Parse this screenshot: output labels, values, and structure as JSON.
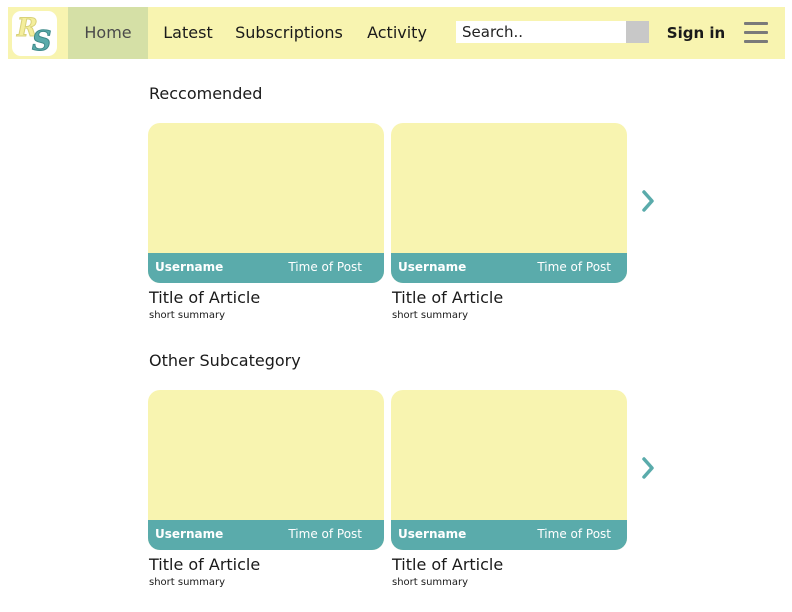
{
  "colors": {
    "header_bg": "#f8f4b0",
    "active_tab_bg": "#d5e0a6",
    "accent_teal": "#5aabab",
    "card_bg": "#f8f4b0",
    "search_button": "#c8c8c8",
    "menu_icon": "#7a7a7a"
  },
  "header": {
    "logo": {
      "letter1": "R",
      "letter2": "S"
    },
    "tabs": [
      {
        "label": "Home",
        "active": true
      },
      {
        "label": "Latest",
        "active": false
      },
      {
        "label": "Subscriptions",
        "active": false
      },
      {
        "label": "Activity",
        "active": false
      }
    ],
    "search": {
      "placeholder": "Search.."
    },
    "sign_in": "Sign in",
    "menu_icon": "hamburger-menu-icon"
  },
  "sections": [
    {
      "title": "Reccomended",
      "next_icon": "chevron-right-icon",
      "cards": [
        {
          "username": "Username",
          "time": "Time of Post",
          "title": "Title of Article",
          "summary": "short summary"
        },
        {
          "username": "Username",
          "time": "Time of Post",
          "title": "Title of Article",
          "summary": "short summary"
        }
      ]
    },
    {
      "title": "Other Subcategory",
      "next_icon": "chevron-right-icon",
      "cards": [
        {
          "username": "Username",
          "time": "Time of Post",
          "title": "Title of Article",
          "summary": "short summary"
        },
        {
          "username": "Username",
          "time": "Time of Post",
          "title": "Title of Article",
          "summary": "short summary"
        }
      ]
    }
  ]
}
